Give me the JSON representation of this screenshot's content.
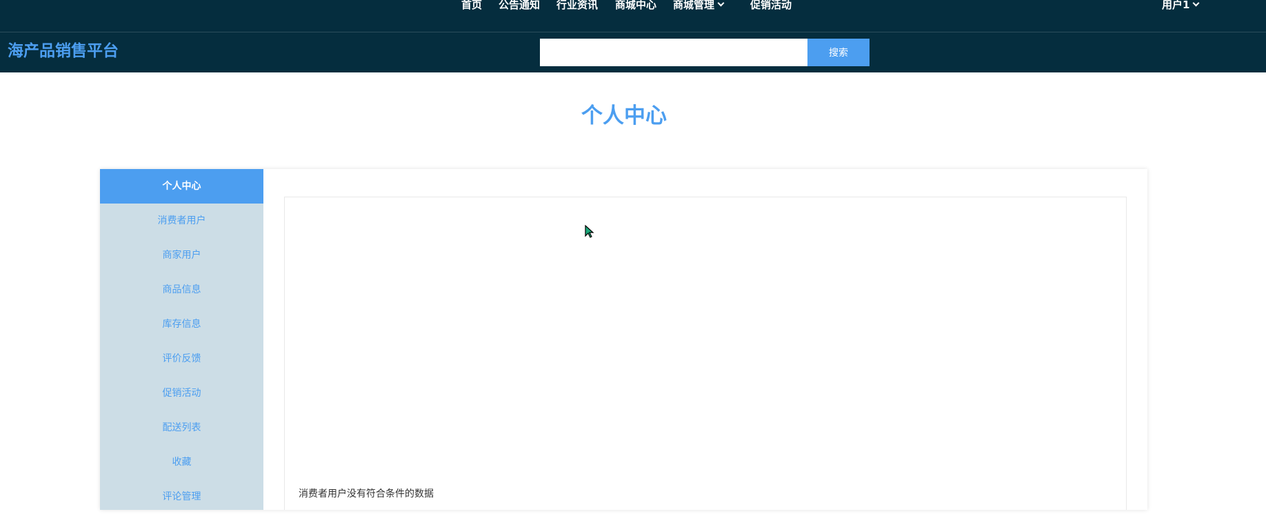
{
  "nav": {
    "items": [
      {
        "label": "首页"
      },
      {
        "label": "公告通知"
      },
      {
        "label": "行业资讯"
      },
      {
        "label": "商城中心"
      },
      {
        "label": "商城管理"
      },
      {
        "label": "促销活动"
      }
    ],
    "user_label": "用户1"
  },
  "header": {
    "site_title": "海产品销售平台",
    "search_placeholder": "",
    "search_value": "",
    "search_button": "搜索"
  },
  "page": {
    "heading": "个人中心"
  },
  "sidebar": {
    "items": [
      {
        "label": "个人中心",
        "active": true
      },
      {
        "label": "消费者用户"
      },
      {
        "label": "商家用户"
      },
      {
        "label": "商品信息"
      },
      {
        "label": "库存信息"
      },
      {
        "label": "评价反馈"
      },
      {
        "label": "促销活动"
      },
      {
        "label": "配送列表"
      },
      {
        "label": "收藏"
      },
      {
        "label": "评论管理"
      }
    ]
  },
  "content": {
    "empty_message": "消费者用户没有符合条件的数据"
  },
  "colors": {
    "header_bg": "#052d3e",
    "accent": "#4c9ef0",
    "sidebar_bg": "#ccdde6"
  },
  "icons": {
    "dropdown": "chevron-down-icon",
    "cursor": "mouse-pointer-icon"
  }
}
